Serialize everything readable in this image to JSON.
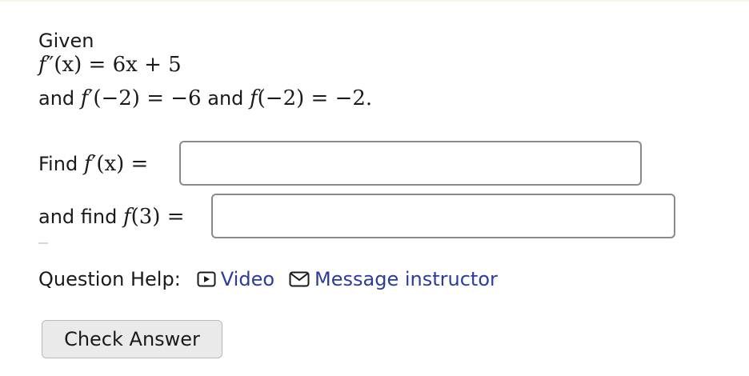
{
  "question": {
    "given_label": "Given",
    "second_derivative": {
      "lhs_fn": "f",
      "lhs_primes": "″",
      "lhs_arg": "(x)",
      "equals": " = ",
      "rhs": "6x + 5"
    },
    "conditions": {
      "and_1": "and",
      "cond1_fn": "f",
      "cond1_primes": "′",
      "cond1_expr": "(−2) = −6",
      "and_2": "and",
      "cond2_fn": "f",
      "cond2_expr": "(−2) = −2."
    }
  },
  "parts": [
    {
      "prefix": "Find",
      "fn": "f",
      "primes": "′",
      "arg": "(x)",
      "equals": " =",
      "value": ""
    },
    {
      "prefix": "and find",
      "fn": "f",
      "arg": "(3)",
      "equals": " =",
      "value": ""
    }
  ],
  "help": {
    "label": "Question Help:",
    "video": {
      "label": "Video",
      "icon": "video-play-icon"
    },
    "message": {
      "label": "Message instructor",
      "icon": "envelope-icon"
    },
    "link_color": "#2a3ba6"
  },
  "check_answer_label": "Check Answer"
}
